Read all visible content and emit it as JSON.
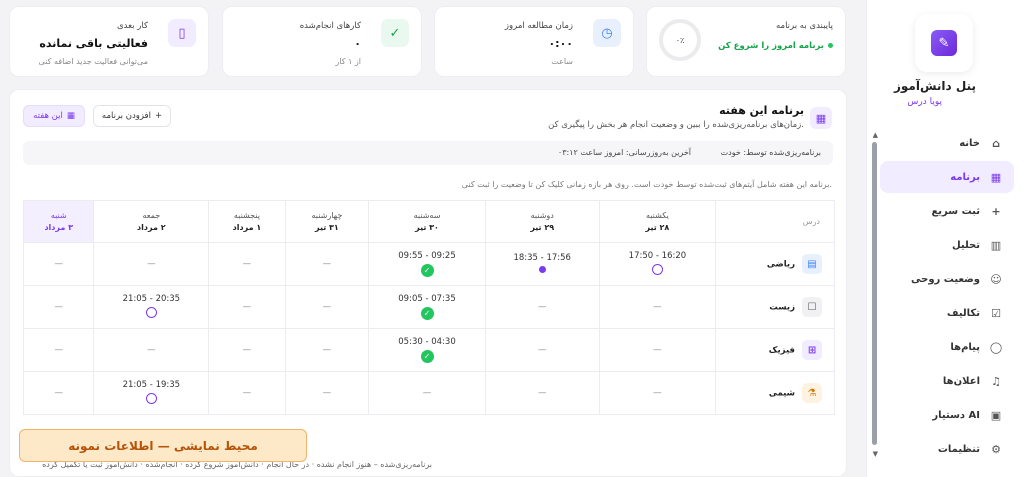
{
  "sidebar": {
    "brand_name": "پنل دانش‌آموز",
    "brand_sub": "پویا درس",
    "items": [
      {
        "label": "خانه",
        "icon": "home-icon",
        "glyph": "⌂",
        "active": false
      },
      {
        "label": "برنامه",
        "icon": "calendar-icon",
        "glyph": "▦",
        "active": true
      },
      {
        "label": "ثبت سریع",
        "icon": "plus-icon",
        "glyph": "+",
        "active": false
      },
      {
        "label": "تحلیل",
        "icon": "bar-chart-icon",
        "glyph": "▥",
        "active": false
      },
      {
        "label": "وضعیت روحی",
        "icon": "mood-icon",
        "glyph": "☺",
        "active": false
      },
      {
        "label": "تکالیف",
        "icon": "checkbox-icon",
        "glyph": "☑",
        "active": false
      },
      {
        "label": "پیام‌ها",
        "icon": "chat-icon",
        "glyph": "◯",
        "active": false
      },
      {
        "label": "اعلان‌ها",
        "icon": "bell-icon",
        "glyph": "♫",
        "active": false
      },
      {
        "label": "دستیار AI",
        "icon": "robot-icon",
        "glyph": "▣",
        "active": false
      },
      {
        "label": "تنظیمات",
        "icon": "gear-icon",
        "glyph": "⚙",
        "active": false
      }
    ]
  },
  "cards": {
    "adherence": {
      "title": "پایبندی به برنامه",
      "status": "برنامه امروز را شروع کن",
      "percent": "۰٪"
    },
    "study_time": {
      "title": "زمان مطالعه امروز",
      "value": "۰:۰۰",
      "sub": "ساعت"
    },
    "done": {
      "title": "کارهای انجام‌شده",
      "value": "۰",
      "sub": "از ۱ کار"
    },
    "next": {
      "title": "کار بعدی",
      "value": "فعالیتی باقی نمانده",
      "sub": "می‌توانی فعالیت جدید اضافه کنی"
    }
  },
  "main": {
    "title": "برنامه این هفته",
    "desc": "زمان‌های برنامه‌ریزی‌شده را ببین و وضعیت انجام هر بخش را پیگیری کن.",
    "btn_week": "این هفته",
    "btn_add": "افزودن برنامه",
    "planner": "برنامه‌ریزی‌شده توسط: خودت",
    "updated": "آخرین به‌روزرسانی: امروز ساعت ۰۳:۱۲",
    "note": "برنامه این هفته شامل آیتم‌های ثبت‌شده توسط خودت است. روی هر بازه زمانی کلیک کن تا وضعیت را ثبت کنی.",
    "legend": "برنامه‌ریزی‌شده – هنوز انجام نشده · در حال انجام · دانش‌آموز شروع کرده · انجام‌شده · دانش‌آموز ثبت یا تکمیل کرده",
    "demo": "محیط نمایشی — اطلاعات نمونه"
  },
  "table": {
    "subject_header": "درس",
    "days": [
      {
        "name": "یکشنبه",
        "date": "۲۸ تیر"
      },
      {
        "name": "دوشنبه",
        "date": "۲۹ تیر"
      },
      {
        "name": "سه‌شنبه",
        "date": "۳۰ تیر"
      },
      {
        "name": "چهارشنبه",
        "date": "۳۱ تیر"
      },
      {
        "name": "پنجشنبه",
        "date": "۱ مرداد"
      },
      {
        "name": "جمعه",
        "date": "۲ مرداد"
      },
      {
        "name": "شنبه",
        "date": "۳ مرداد",
        "today": true
      }
    ],
    "rows": [
      {
        "subject": "ریاضی",
        "icon": "calculator-icon",
        "glyph": "▤",
        "color": "#3b82f6",
        "bg": "#e8f0fe",
        "slots": [
          {
            "time": "16:20 - 17:50",
            "status": "open"
          },
          {
            "time": "17:56 - 18:35",
            "status": "progress"
          },
          {
            "time": "09:25 - 09:55",
            "status": "done"
          },
          null,
          null,
          null,
          null
        ]
      },
      {
        "subject": "زیست",
        "icon": "book-icon",
        "glyph": "☐",
        "color": "#555555",
        "bg": "#f1f1f4",
        "slots": [
          null,
          null,
          {
            "time": "07:35 - 09:05",
            "status": "done"
          },
          null,
          null,
          {
            "time": "20:35 - 21:05",
            "status": "open"
          },
          null
        ]
      },
      {
        "subject": "فیزیک",
        "icon": "atom-icon",
        "glyph": "⊞",
        "color": "#7c3aed",
        "bg": "#f1ecff",
        "slots": [
          null,
          null,
          {
            "time": "04:30 - 05:30",
            "status": "done"
          },
          null,
          null,
          null,
          null
        ]
      },
      {
        "subject": "شیمی",
        "icon": "flask-icon",
        "glyph": "⚗",
        "color": "#d97706",
        "bg": "#fef3e2",
        "slots": [
          null,
          null,
          null,
          null,
          null,
          {
            "time": "19:35 - 21:05",
            "status": "open"
          },
          null
        ]
      }
    ],
    "empty": "—"
  },
  "colors": {
    "accent": "#7c3aed",
    "done": "#22c55e",
    "demo_bg": "#fde8c8"
  }
}
